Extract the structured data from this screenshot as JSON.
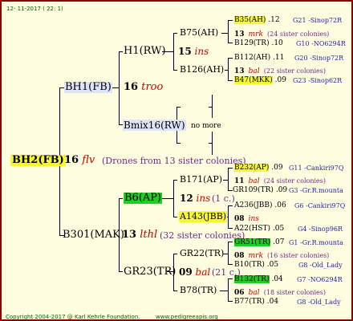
{
  "header": {
    "date": "12- 11-2017 ( 22:  1)"
  },
  "footer": {
    "copyright": "Copyright 2004-2017 @ Karl Kehrle Foundation.",
    "site": "www.pedigreeapis.org"
  },
  "root": {
    "id": "BH2(FB)",
    "gen": "16",
    "sym": "flv",
    "note": "(Drones from 13 sister colonies)"
  },
  "g1": {
    "sire": {
      "id": "BH1(FB)",
      "gen": "16",
      "sym": "troo"
    },
    "dam": {
      "id": "B301(MAK)",
      "gen": "13",
      "sym": "lthl",
      "note": "(32 sister colonies)"
    }
  },
  "g2": {
    "h1": {
      "id": "H1(RW)",
      "gen": "15",
      "sym": "ins"
    },
    "bmix": {
      "id": "Bmix16(RW)",
      "note": "no more"
    },
    "b6": {
      "id": "B6(AP)",
      "gen": "12",
      "sym": "ins",
      "note": "(1 c.)"
    },
    "gr23": {
      "id": "GR23(TR)",
      "gen": "09",
      "sym": "bal",
      "note": "(21 c.)"
    }
  },
  "g3": {
    "b75": "B75(AH)",
    "b126": "B126(AH)",
    "b171": "B171(AP)",
    "a143": "A143(JBB)",
    "gr22": "GR22(TR)",
    "b78": "B78(TR)"
  },
  "g4": {
    "r1": {
      "id": "B35(AH)",
      "val": ".12",
      "code": "G21 -Sinop72R"
    },
    "r2": {
      "gen": "13",
      "sym": "mrk",
      "note": "(24 sister colonies)"
    },
    "r3": {
      "id": "B129(TR)",
      "val": ".10",
      "code": "G10 -NO6294R"
    },
    "r4": {
      "id": "B112(AH)",
      "val": ".11",
      "code": "G20 -Sinop72R"
    },
    "r5": {
      "gen": "13",
      "sym": "bal",
      "note": "(22 sister colonies)"
    },
    "r6": {
      "id": "B47(MKK)",
      "val": ".09",
      "code": "G23 -Sinop62R"
    },
    "r7": {
      "id": "B232(AP)",
      "val": ".09",
      "code": "G11 -Cankiri97Q"
    },
    "r8": {
      "gen": "11",
      "sym": "bal",
      "note": "(24 sister colonies)"
    },
    "r9": {
      "id": "GR109(TR)",
      "val": ".09",
      "code": "G3 -Gr.R.mounta"
    },
    "r10": {
      "id": "A236(JBB)",
      "val": ".06",
      "code": "G6 -Cankiri97Q"
    },
    "r11": {
      "gen": "08",
      "sym": "ins"
    },
    "r12": {
      "id": "A22(HST)",
      "val": ".05",
      "code": "G4 -Sinop96R"
    },
    "r13": {
      "id": "GR51(TR)",
      "val": ".07",
      "code": "G1 -Gr.R.mounta"
    },
    "r14": {
      "gen": "08",
      "sym": "mrk",
      "note": "(16 sister colonies)"
    },
    "r15": {
      "id": "B10(TR)",
      "val": ".05",
      "code": "G8 -Old_Lady"
    },
    "r16": {
      "id": "B132(TR)",
      "val": ".04",
      "code": "G7 -NO6294R"
    },
    "r17": {
      "gen": "06",
      "sym": "bal",
      "note": "(18 sister colonies)"
    },
    "r18": {
      "id": "B77(TR)",
      "val": ".04",
      "code": "G8 -Old_Lady"
    }
  }
}
